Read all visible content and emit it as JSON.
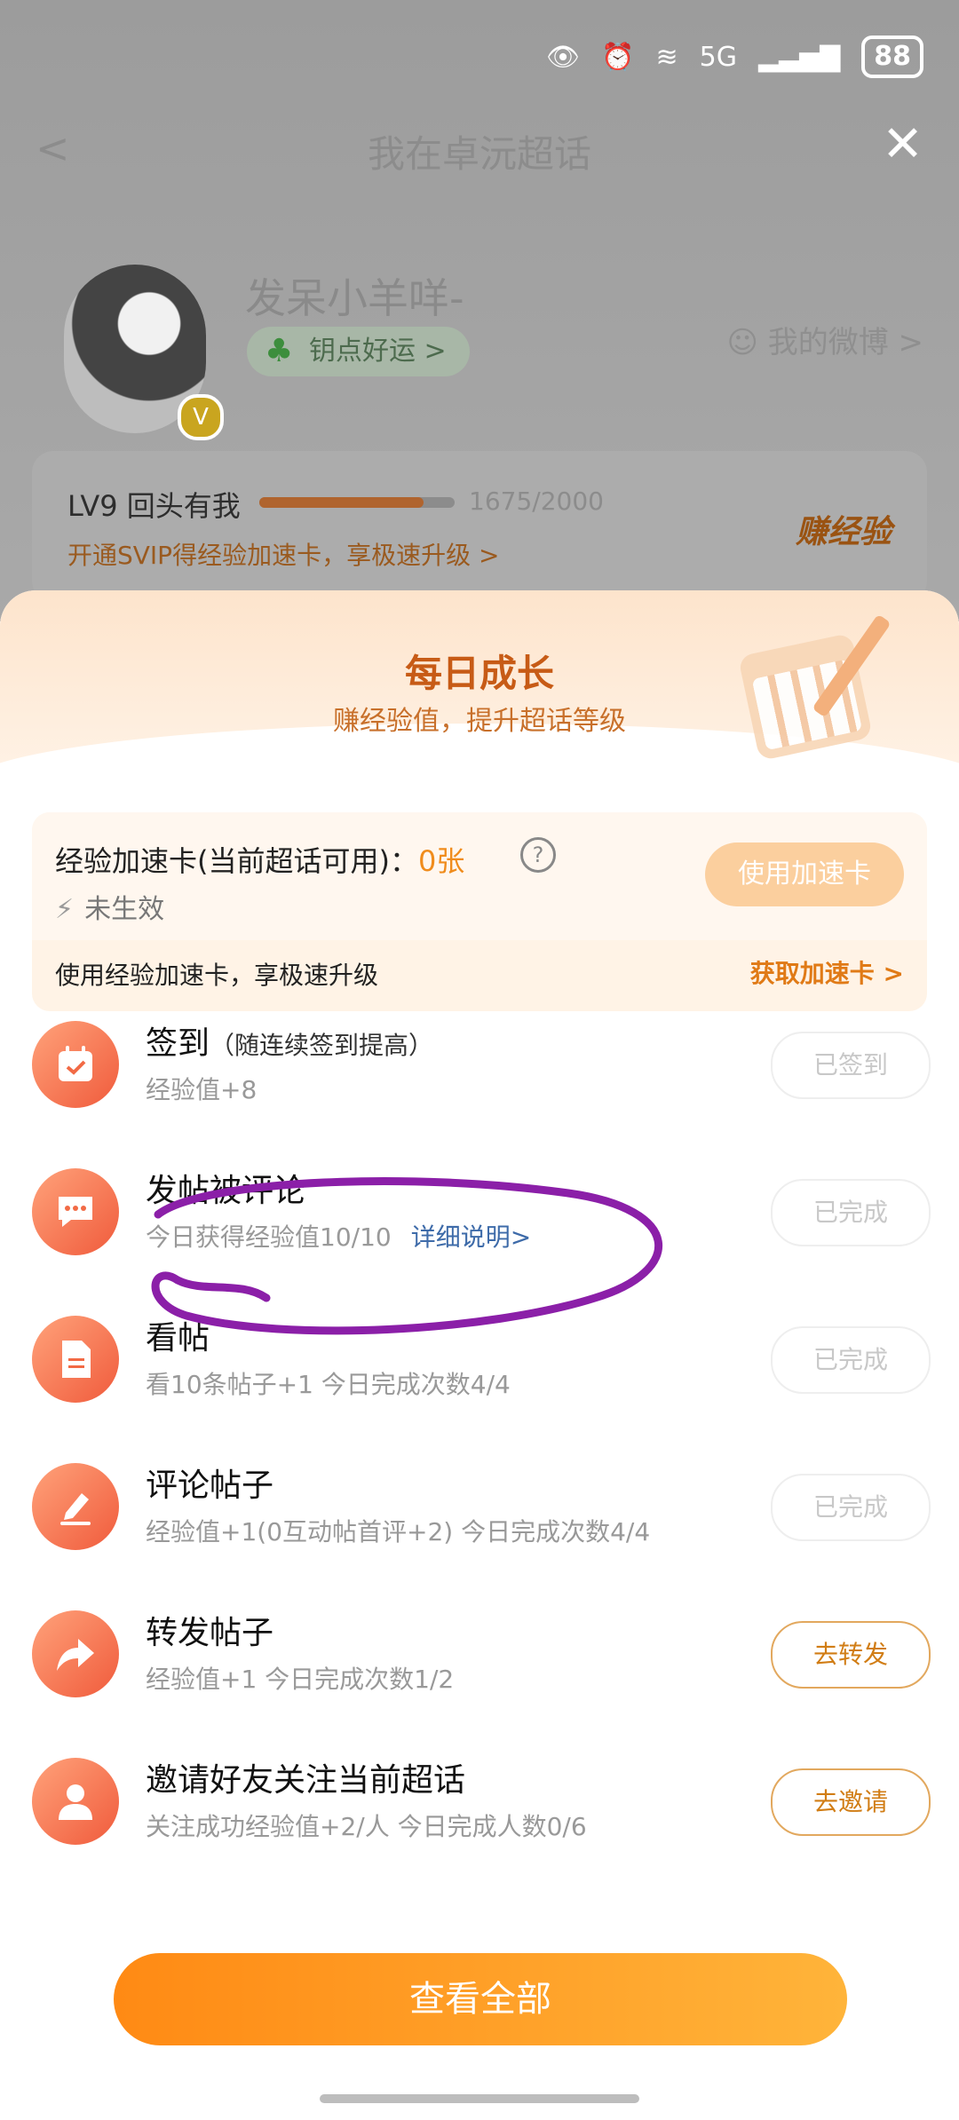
{
  "status_bar": {
    "network": "5G",
    "battery": "88"
  },
  "background": {
    "title": "我在卓沅超话",
    "nickname": "发呆小羊咩-",
    "luck_label": "钥点好运 >",
    "weibo_label": "我的微博 >",
    "level_label": "LV9 回头有我",
    "exp_progress": "1675/2000",
    "exp_fraction": 0.84,
    "svip_promo": "开通SVIP得经验加速卡，享极速升级 >",
    "earn_label": "赚经验"
  },
  "sheet": {
    "title": "每日成长",
    "subtitle": "赚经验值，提升超话等级",
    "speed_card": {
      "label": "经验加速卡(当前超话可用)：",
      "count": "0张",
      "status": "未生效",
      "use_button": "使用加速卡",
      "promo": "使用经验加速卡，享极速升级",
      "get_link": "获取加速卡 >"
    },
    "tasks": [
      {
        "title": "签到",
        "hint": "（随连续签到提高）",
        "desc": "经验值+8",
        "link": "",
        "button": "已签到",
        "icon": "calendar-check-icon"
      },
      {
        "title": "发帖被评论",
        "hint": "",
        "desc": "今日获得经验值10/10",
        "link": "详细说明>",
        "button": "已完成",
        "icon": "chat-bubble-icon"
      },
      {
        "title": "看帖",
        "hint": "",
        "desc": "看10条帖子+1   今日完成次数4/4",
        "link": "",
        "button": "已完成",
        "icon": "document-icon"
      },
      {
        "title": "评论帖子",
        "hint": "",
        "desc": "经验值+1(0互动帖首评+2)  今日完成次数4/4",
        "link": "",
        "button": "已完成",
        "icon": "pencil-icon"
      },
      {
        "title": "转发帖子",
        "hint": "",
        "desc": "经验值+1   今日完成次数1/2",
        "link": "",
        "button": "去转发",
        "icon": "share-arrow-icon"
      },
      {
        "title": "邀请好友关注当前超话",
        "hint": "",
        "desc": "关注成功经验值+2/人   今日完成人数0/6",
        "link": "",
        "button": "去邀请",
        "icon": "person-icon"
      }
    ],
    "view_all": "查看全部"
  },
  "colors": {
    "accent": "#ff9a1f",
    "title_orange": "#c75b16",
    "annotation": "#8b1fa8"
  }
}
